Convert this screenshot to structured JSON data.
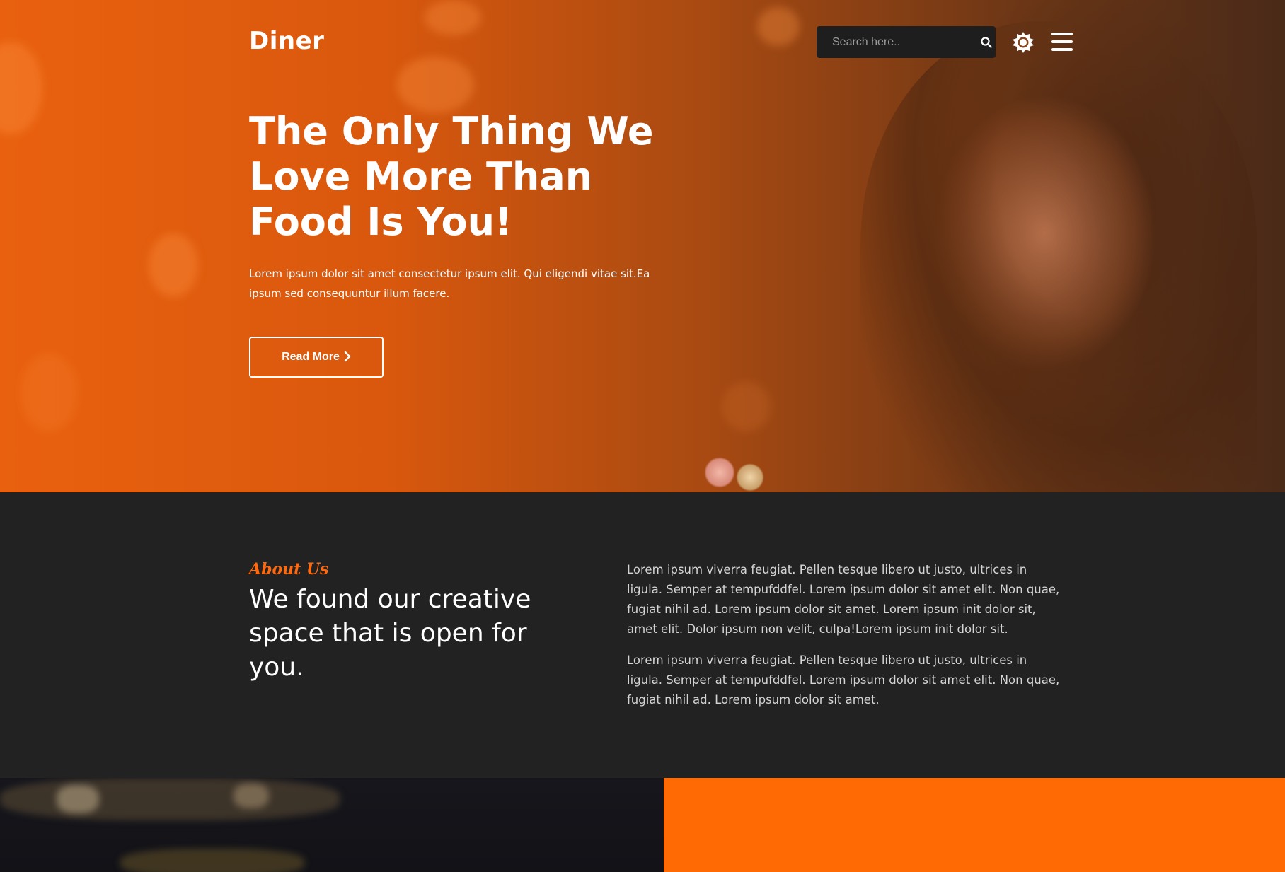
{
  "brand": {
    "name": "Diner"
  },
  "search": {
    "placeholder": "Search here.."
  },
  "hero": {
    "title": "The Only Thing We Love More Than Food Is You!",
    "text": "Lorem ipsum dolor sit amet consectetur ipsum elit. Qui eligendi vitae sit.Ea ipsum sed consequuntur illum facere.",
    "button_label": "Read More"
  },
  "about": {
    "tag": "About Us",
    "title": "We found our creative space that is open for you.",
    "paragraphs": [
      "Lorem ipsum viverra feugiat. Pellen tesque libero ut justo, ultrices in ligula. Semper at tempufddfel. Lorem ipsum dolor sit amet elit. Non quae, fugiat nihil ad. Lorem ipsum dolor sit amet. Lorem ipsum init dolor sit, amet elit. Dolor ipsum non velit, culpa!Lorem ipsum init dolor sit.",
      "Lorem ipsum viverra feugiat. Pellen tesque libero ut justo, ultrices in ligula. Semper at tempufddfel. Lorem ipsum dolor sit amet elit. Non quae, fugiat nihil ad. Lorem ipsum dolor sit amet."
    ]
  },
  "icons": {
    "search": "search-icon",
    "theme": "sun-icon",
    "menu": "hamburger-menu-icon",
    "chevron": "chevron-right-icon"
  },
  "colors": {
    "accent": "#ff6a05",
    "dark_bg": "#222222",
    "search_bg": "#1e1e1e"
  }
}
